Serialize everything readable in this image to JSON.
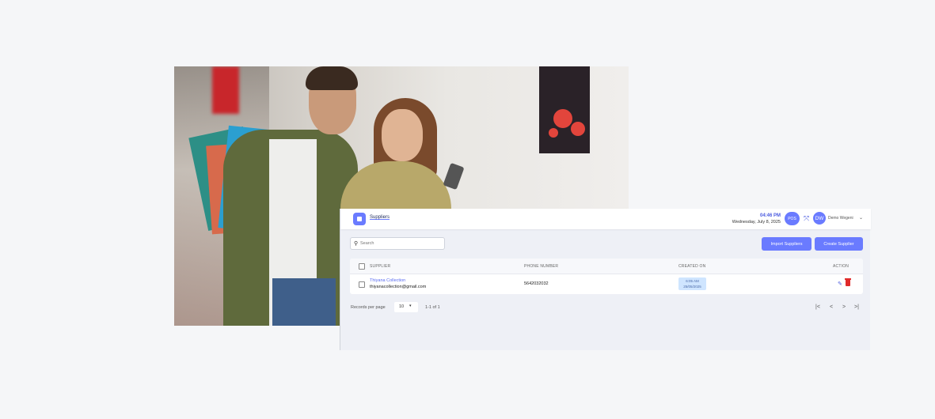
{
  "header": {
    "title": "Suppliers",
    "time": "04:46 PM",
    "date": "Wednesday, July 8, 2025",
    "pos_label": "POS",
    "avatar_initials": "DW",
    "user_name": "Demo Wegeni"
  },
  "toolbar": {
    "search_placeholder": "Search",
    "import_label": "Import Suppliers",
    "create_label": "Create Supplier"
  },
  "table": {
    "columns": {
      "supplier": "SUPPLIER",
      "phone": "PHONE NUMBER",
      "created": "CREATED ON",
      "action": "ACTION"
    },
    "rows": [
      {
        "name": "Thiyana Collection",
        "email": "thiyanacollection@gmail.com",
        "phone": "5642032032",
        "created_time": "6:05 AM",
        "created_date": "25/05/2025"
      }
    ]
  },
  "pagination": {
    "per_page_label": "Records per page",
    "per_page_value": "10",
    "range": "1-1 of 1"
  },
  "colors": {
    "accent": "#6a7bff",
    "danger": "#e02b2b"
  }
}
